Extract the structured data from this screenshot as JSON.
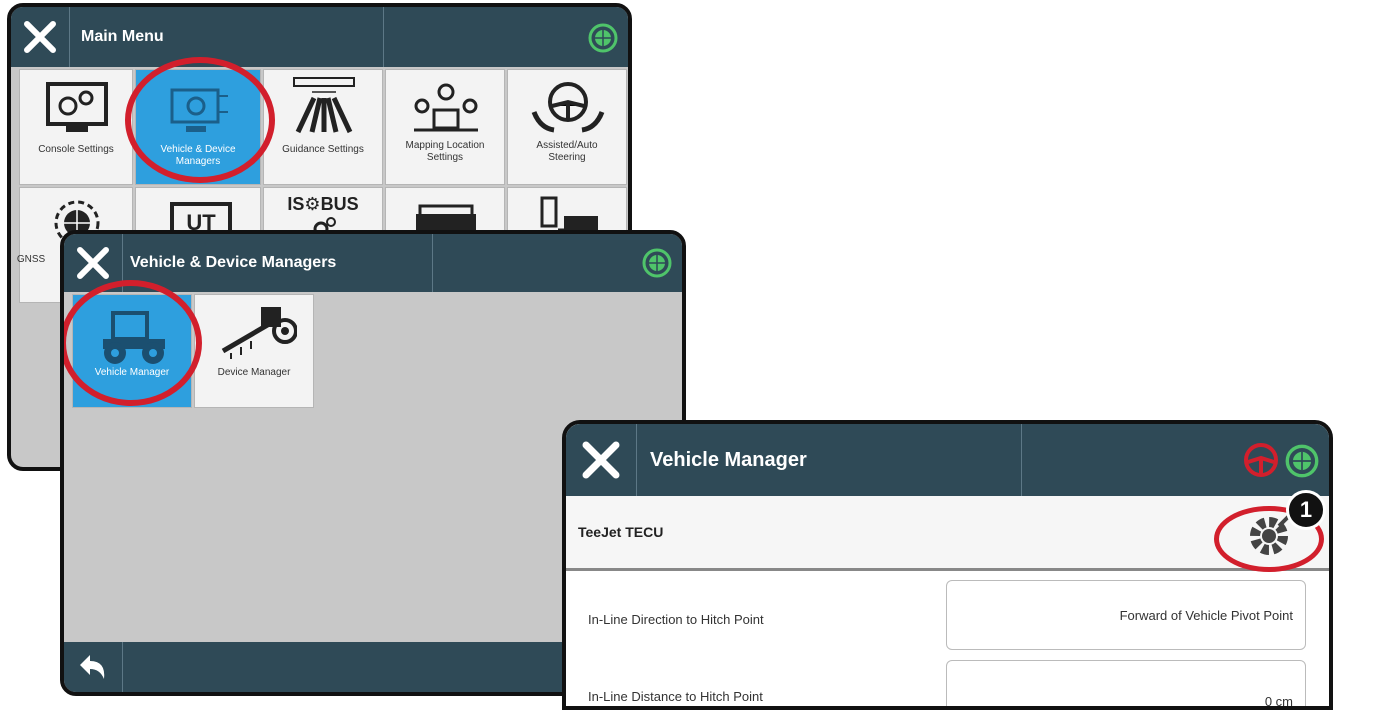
{
  "main_menu": {
    "title": "Main Menu",
    "tiles": [
      {
        "label": "Console Settings"
      },
      {
        "label": "Vehicle & Device Managers"
      },
      {
        "label": "Guidance Settings"
      },
      {
        "label": "Mapping Location Settings"
      },
      {
        "label": "Assisted/Auto Steering"
      },
      {
        "label": "GNSS"
      },
      {
        "label": "UT"
      },
      {
        "label": "IS🙃BUS"
      }
    ],
    "gnss_partial": "S"
  },
  "vdm": {
    "title": "Vehicle & Device Managers",
    "tiles": [
      {
        "label": "Vehicle Manager"
      },
      {
        "label": "Device Manager"
      }
    ]
  },
  "vm": {
    "title": "Vehicle Manager",
    "section": "TeeJet TECU",
    "callout": "1",
    "rows": [
      {
        "label": "In-Line Direction to Hitch Point",
        "value": "Forward of Vehicle Pivot Point"
      },
      {
        "label": "In-Line Distance to Hitch Point",
        "value": "0 cm"
      }
    ]
  },
  "colors": {
    "header": "#2f4a57",
    "selected": "#2e9fde",
    "highlight": "#d21f2c"
  },
  "icons": [
    "close-icon",
    "gnss-globe-icon",
    "steering-wheel-icon",
    "gear-edit-icon",
    "back-arrow-icon"
  ]
}
